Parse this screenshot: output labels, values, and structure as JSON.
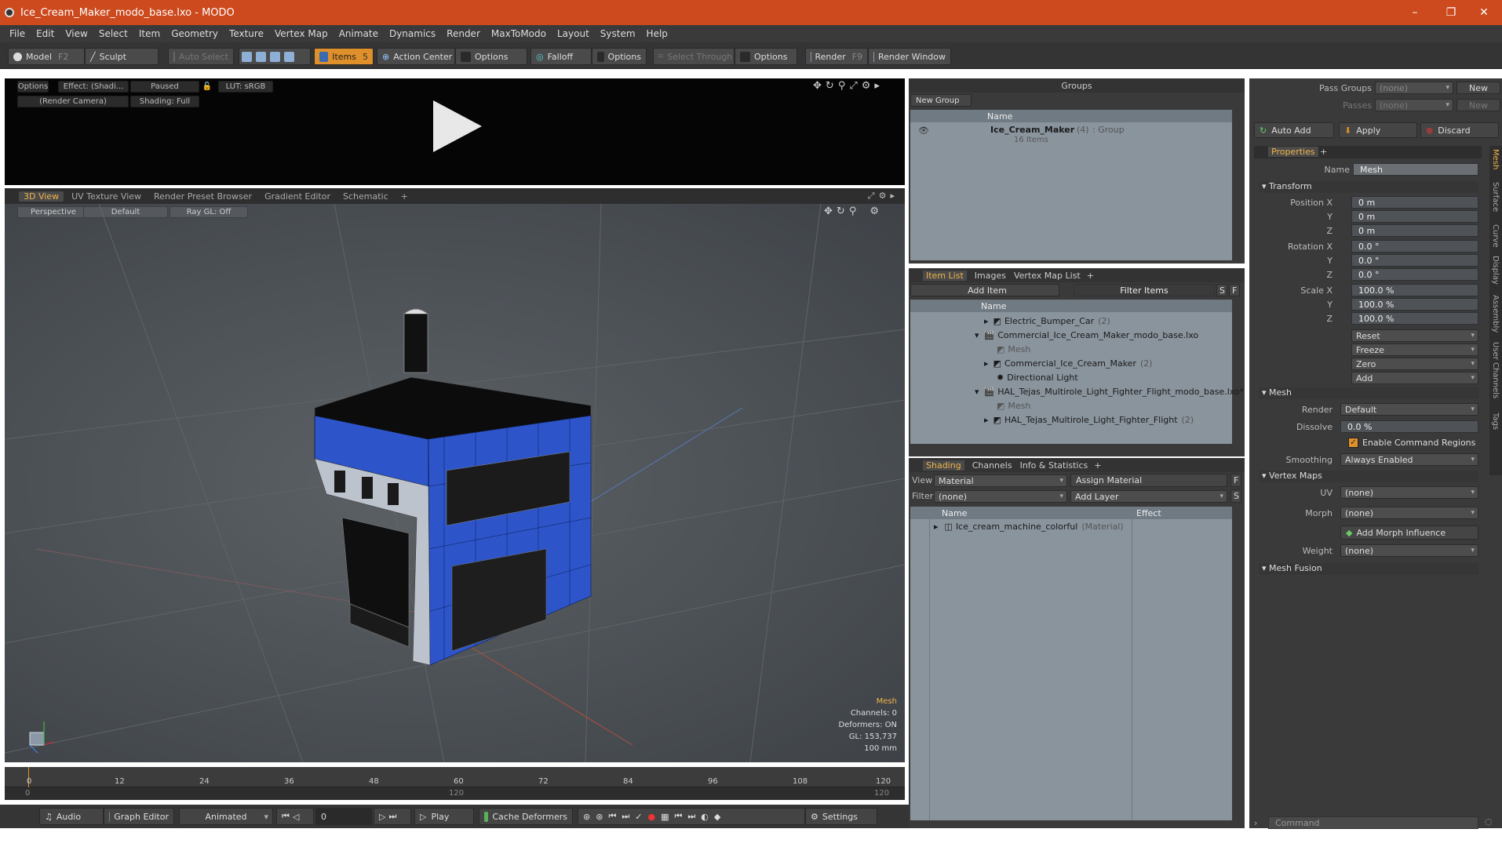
{
  "window": {
    "title": "Ice_Cream_Maker_modo_base.lxo - MODO",
    "min": "–",
    "max": "❐",
    "close": "✕"
  },
  "menu": [
    "File",
    "Edit",
    "View",
    "Select",
    "Item",
    "Geometry",
    "Texture",
    "Vertex Map",
    "Animate",
    "Dynamics",
    "Render",
    "MaxToModo",
    "Layout",
    "System",
    "Help"
  ],
  "toolbar": {
    "model": "Model",
    "model_key": "F2",
    "sculpt": "Sculpt",
    "auto_select": "Auto Select",
    "items": "Items",
    "items_key": "5",
    "action_center": "Action Center",
    "options1": "Options",
    "falloff": "Falloff",
    "options2": "Options",
    "select_through": "Select Through",
    "options3": "Options",
    "render": "Render",
    "render_key": "F9",
    "render_window": "Render Window"
  },
  "preview": {
    "options": "Options",
    "effect": "Effect: (Shadi...",
    "paused": "Paused",
    "lut": "LUT: sRGB",
    "camera": "(Render Camera)",
    "shading": "Shading: Full"
  },
  "viewport_tabs": [
    "3D View",
    "UV Texture View",
    "Render Preset Browser",
    "Gradient Editor",
    "Schematic",
    "+"
  ],
  "viewport": {
    "perspective": "Perspective",
    "default": "Default",
    "raygl": "Ray GL: Off",
    "info": {
      "mesh": "Mesh",
      "channels": "Channels: 0",
      "deformers": "Deformers: ON",
      "gl": "GL: 153,737",
      "scale": "100 mm"
    }
  },
  "timeline": {
    "ticks": [
      "0",
      "12",
      "24",
      "36",
      "48",
      "60",
      "72",
      "84",
      "96",
      "108",
      "120"
    ],
    "sub_ticks": [
      "0",
      "120",
      "120"
    ]
  },
  "bottombar": {
    "audio": "Audio",
    "graph_editor": "Graph Editor",
    "animated": "Animated",
    "frame": "0",
    "play": "Play",
    "cache": "Cache Deformers",
    "settings": "Settings"
  },
  "groups": {
    "title": "Groups",
    "new_group": "New Group",
    "name_col": "Name",
    "group_name": "Ice_Cream_Maker",
    "group_count": "(4)",
    "group_type": ": Group",
    "group_items": "16 Items"
  },
  "itemlist": {
    "tabs": [
      "Item List",
      "Images",
      "Vertex Map List",
      "+"
    ],
    "add_item": "Add Item",
    "filter": "Filter Items",
    "s": "S",
    "f": "F",
    "name_col": "Name",
    "rows": [
      {
        "label": "Electric_Bumper_Car",
        "count": "(2)"
      },
      {
        "label": "Commercial_Ice_Cream_Maker_modo_base.lxo",
        "count": ""
      },
      {
        "label": "Mesh",
        "count": ""
      },
      {
        "label": "Commercial_Ice_Cream_Maker",
        "count": "(2)"
      },
      {
        "label": "Directional Light",
        "count": ""
      },
      {
        "label": "HAL_Tejas_Multirole_Light_Fighter_Flight_modo_base.lxo*",
        "count": ""
      },
      {
        "label": "Mesh",
        "count": ""
      },
      {
        "label": "HAL_Tejas_Multirole_Light_Fighter_Flight",
        "count": "(2)"
      }
    ]
  },
  "shading": {
    "tabs": [
      "Shading",
      "Channels",
      "Info & Statistics",
      "+"
    ],
    "view_label": "View",
    "view_val": "Material",
    "assign": "Assign Material",
    "f": "F",
    "filter_label": "Filter",
    "filter_val": "(none)",
    "add_layer": "Add Layer",
    "s": "S",
    "name_col": "Name",
    "effect_col": "Effect",
    "material": "Ice_cream_machine_colorful",
    "material_type": "(Material)"
  },
  "props": {
    "pass_groups": "Pass Groups",
    "passes": "Passes",
    "none": "(none)",
    "new": "New",
    "auto_add": "Auto Add",
    "apply": "Apply",
    "discard": "Discard",
    "tab": "Properties",
    "plus": "+",
    "name_label": "Name",
    "name_val": "Mesh",
    "transform": "Transform",
    "pos_x": "Position X",
    "y": "Y",
    "z": "Z",
    "rot_x": "Rotation X",
    "scale_x": "Scale X",
    "pos": [
      "0 m",
      "0 m",
      "0 m"
    ],
    "rot": [
      "0.0 °",
      "0.0 °",
      "0.0 °"
    ],
    "scale": [
      "100.0 %",
      "100.0 %",
      "100.0 %"
    ],
    "reset": "Reset",
    "freeze": "Freeze",
    "zero": "Zero",
    "add": "Add",
    "mesh": "Mesh",
    "render_label": "Render",
    "render_val": "Default",
    "dissolve_label": "Dissolve",
    "dissolve_val": "0.0 %",
    "enable_cmd": "Enable Command Regions",
    "smoothing_label": "Smoothing",
    "smoothing_val": "Always Enabled",
    "vertex_maps": "Vertex Maps",
    "uv_label": "UV",
    "uv_val": "(none)",
    "morph_label": "Morph",
    "morph_val": "(none)",
    "add_morph": "Add Morph Influence",
    "weight_label": "Weight",
    "weight_val": "(none)",
    "mesh_fusion": "Mesh Fusion",
    "command": "Command",
    "side_tabs": [
      "Mesh",
      "Surface",
      "Curve",
      "Display",
      "Assembly",
      "User Channels",
      "Tags"
    ]
  },
  "colors": {
    "title_bar": "#cc4a1e",
    "accent": "#e0902a",
    "machine_blue": "#2d55c9"
  }
}
